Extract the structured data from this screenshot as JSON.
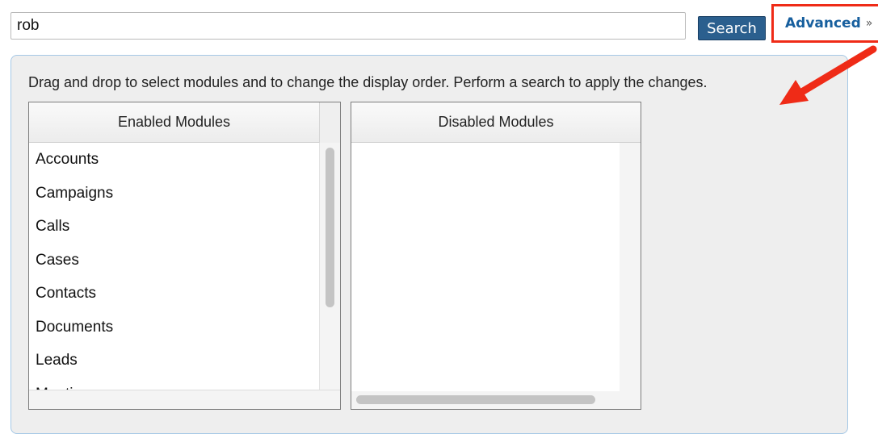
{
  "search": {
    "query": "rob",
    "button_label": "Search",
    "advanced_label": "Advanced",
    "advanced_icon": "double-chevron-down-icon"
  },
  "panel": {
    "instructions": "Drag and drop to select modules and to change the display order. Perform a search to apply the changes.",
    "enabled": {
      "header": "Enabled Modules",
      "items": [
        "Accounts",
        "Campaigns",
        "Calls",
        "Cases",
        "Contacts",
        "Documents",
        "Leads",
        "Meetings"
      ]
    },
    "disabled": {
      "header": "Disabled Modules",
      "items": []
    }
  },
  "colors": {
    "accent": "#2b5f8e",
    "link": "#175f9e",
    "highlight": "#ef2b17"
  }
}
